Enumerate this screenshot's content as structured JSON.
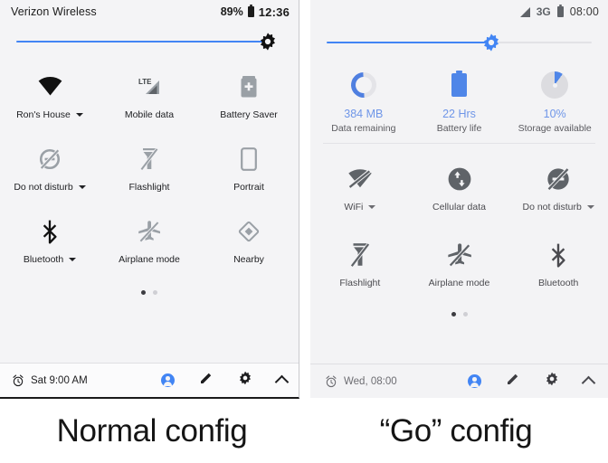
{
  "normal": {
    "status_bar": {
      "carrier": "Verizon Wireless",
      "battery_percent": "89%",
      "battery_icon": "battery-icon",
      "clock": "12:36"
    },
    "brightness": {
      "icon": "brightness-sun-icon",
      "value_percent": 88
    },
    "tiles": [
      {
        "icon": "wifi-icon",
        "label": "Ron's House",
        "expandable": true
      },
      {
        "icon": "mobile-data-lte-icon",
        "label": "Mobile data",
        "expandable": false
      },
      {
        "icon": "battery-saver-icon",
        "label": "Battery Saver",
        "expandable": false
      },
      {
        "icon": "do-not-disturb-off-icon",
        "label": "Do not disturb",
        "expandable": true
      },
      {
        "icon": "flashlight-off-icon",
        "label": "Flashlight",
        "expandable": false
      },
      {
        "icon": "portrait-icon",
        "label": "Portrait",
        "expandable": false
      },
      {
        "icon": "bluetooth-icon",
        "label": "Bluetooth",
        "expandable": true
      },
      {
        "icon": "airplane-mode-off-icon",
        "label": "Airplane mode",
        "expandable": false
      },
      {
        "icon": "nearby-icon",
        "label": "Nearby",
        "expandable": false
      }
    ],
    "pager": {
      "pages": 2,
      "active": 1
    },
    "footer": {
      "alarm_icon": "alarm-clock-icon",
      "alarm_text": "Sat 9:00 AM",
      "icons": [
        "user-avatar-icon",
        "edit-pencil-icon",
        "settings-gear-icon",
        "collapse-chevron-up-icon"
      ]
    },
    "caption": "Normal config"
  },
  "go": {
    "status_bar": {
      "signal_icon": "signal-bars-icon",
      "network": "3G",
      "battery_icon": "battery-icon",
      "clock": "08:00"
    },
    "brightness": {
      "icon": "brightness-sun-icon",
      "value_percent": 62
    },
    "stats": [
      {
        "icon": "data-ring-icon",
        "value": "384 MB",
        "label": "Data remaining"
      },
      {
        "icon": "battery-full-icon",
        "value": "22 Hrs",
        "label": "Battery life"
      },
      {
        "icon": "storage-pie-icon",
        "value": "10%",
        "label": "Storage available"
      }
    ],
    "tiles": [
      {
        "icon": "wifi-off-icon",
        "label": "WiFi",
        "expandable": true
      },
      {
        "icon": "cellular-data-icon",
        "label": "Cellular data",
        "expandable": false
      },
      {
        "icon": "do-not-disturb-off-icon",
        "label": "Do not disturb",
        "expandable": true
      },
      {
        "icon": "flashlight-off-icon",
        "label": "Flashlight",
        "expandable": false
      },
      {
        "icon": "airplane-mode-off-icon",
        "label": "Airplane mode",
        "expandable": false
      },
      {
        "icon": "bluetooth-icon",
        "label": "Bluetooth",
        "expandable": false
      }
    ],
    "pager": {
      "pages": 2,
      "active": 1
    },
    "footer": {
      "alarm_icon": "alarm-clock-icon",
      "alarm_text": "Wed, 08:00",
      "icons": [
        "user-avatar-icon",
        "edit-pencil-icon",
        "settings-gear-icon",
        "collapse-chevron-up-icon"
      ]
    },
    "caption": "“Go” config"
  },
  "colors": {
    "accent_blue": "#4285f4",
    "stat_blue": "#6f96e8",
    "panel_bg": "#f4f4f6",
    "icon_grey": "#9aa0a6",
    "text_dark": "#202124"
  }
}
